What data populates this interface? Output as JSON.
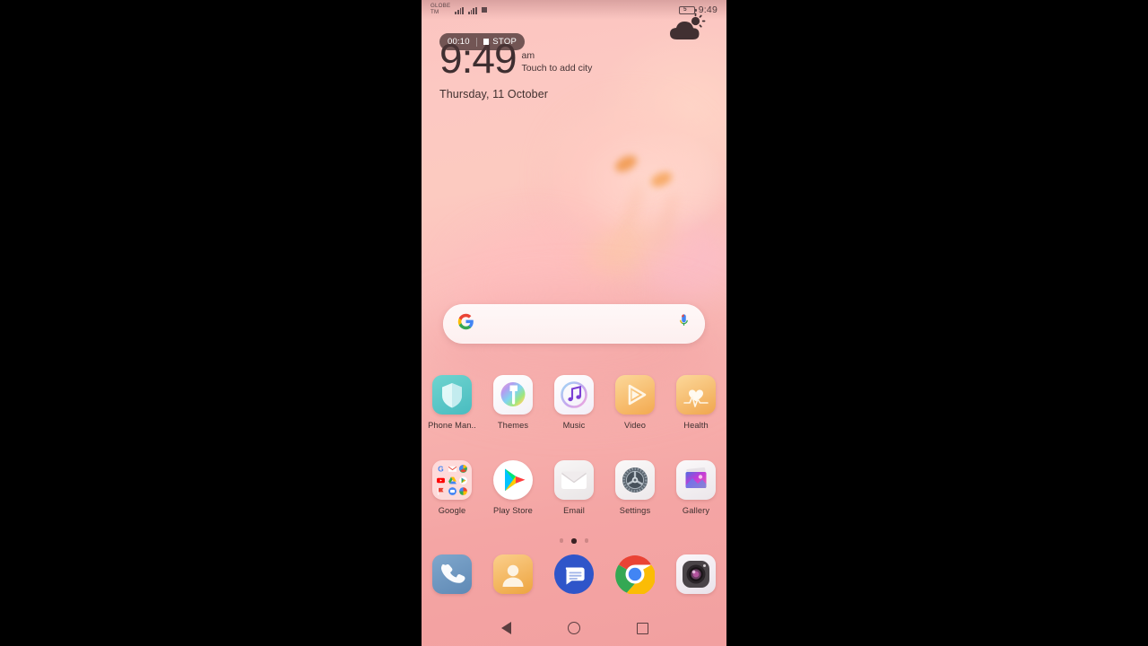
{
  "statusbar": {
    "carrier_line1": "GLOBE",
    "carrier_line2": "TM",
    "signal1_icon": "signal-bars-icon",
    "signal2_icon": "signal-bars-icon",
    "recording_icon": "recording-square-icon",
    "battery_level": "5",
    "time": "9:49"
  },
  "recording_pill": {
    "elapsed": "00:10",
    "stop_label": "STOP",
    "stop_icon": "stop-square-icon"
  },
  "clock_widget": {
    "time": "9:49",
    "meridiem": "am",
    "city_hint": "Touch to add city",
    "date": "Thursday, 11 October",
    "weather_icon": "partly-cloudy-icon"
  },
  "search": {
    "google_icon": "google-g-icon",
    "mic_icon": "microphone-icon",
    "placeholder": "",
    "value": ""
  },
  "app_rows": [
    {
      "row": "row1",
      "apps": [
        {
          "label": "Phone Man..",
          "icon": "phone-manager-icon"
        },
        {
          "label": "Themes",
          "icon": "themes-icon"
        },
        {
          "label": "Music",
          "icon": "music-icon"
        },
        {
          "label": "Video",
          "icon": "video-icon"
        },
        {
          "label": "Health",
          "icon": "health-icon"
        }
      ]
    },
    {
      "row": "row2",
      "apps": [
        {
          "label": "Google",
          "icon": "google-folder-icon"
        },
        {
          "label": "Play Store",
          "icon": "play-store-icon"
        },
        {
          "label": "Email",
          "icon": "email-icon"
        },
        {
          "label": "Settings",
          "icon": "settings-gear-icon"
        },
        {
          "label": "Gallery",
          "icon": "gallery-icon"
        }
      ]
    }
  ],
  "dock": [
    {
      "label": "",
      "icon": "phone-dialer-icon"
    },
    {
      "label": "",
      "icon": "contacts-icon"
    },
    {
      "label": "",
      "icon": "messages-icon"
    },
    {
      "label": "",
      "icon": "chrome-icon"
    },
    {
      "label": "",
      "icon": "camera-icon"
    }
  ],
  "page_indicator": {
    "total": 3,
    "active": 2
  },
  "navbar": {
    "back_icon": "back-triangle-icon",
    "home_icon": "home-circle-icon",
    "recents_icon": "recents-square-icon"
  },
  "colors": {
    "wallpaper_pink": "#f2a0a0",
    "wallpaper_peach": "#fbc4c0",
    "text_dark": "#3d2f2f",
    "pill_bg": "#4a3436"
  }
}
